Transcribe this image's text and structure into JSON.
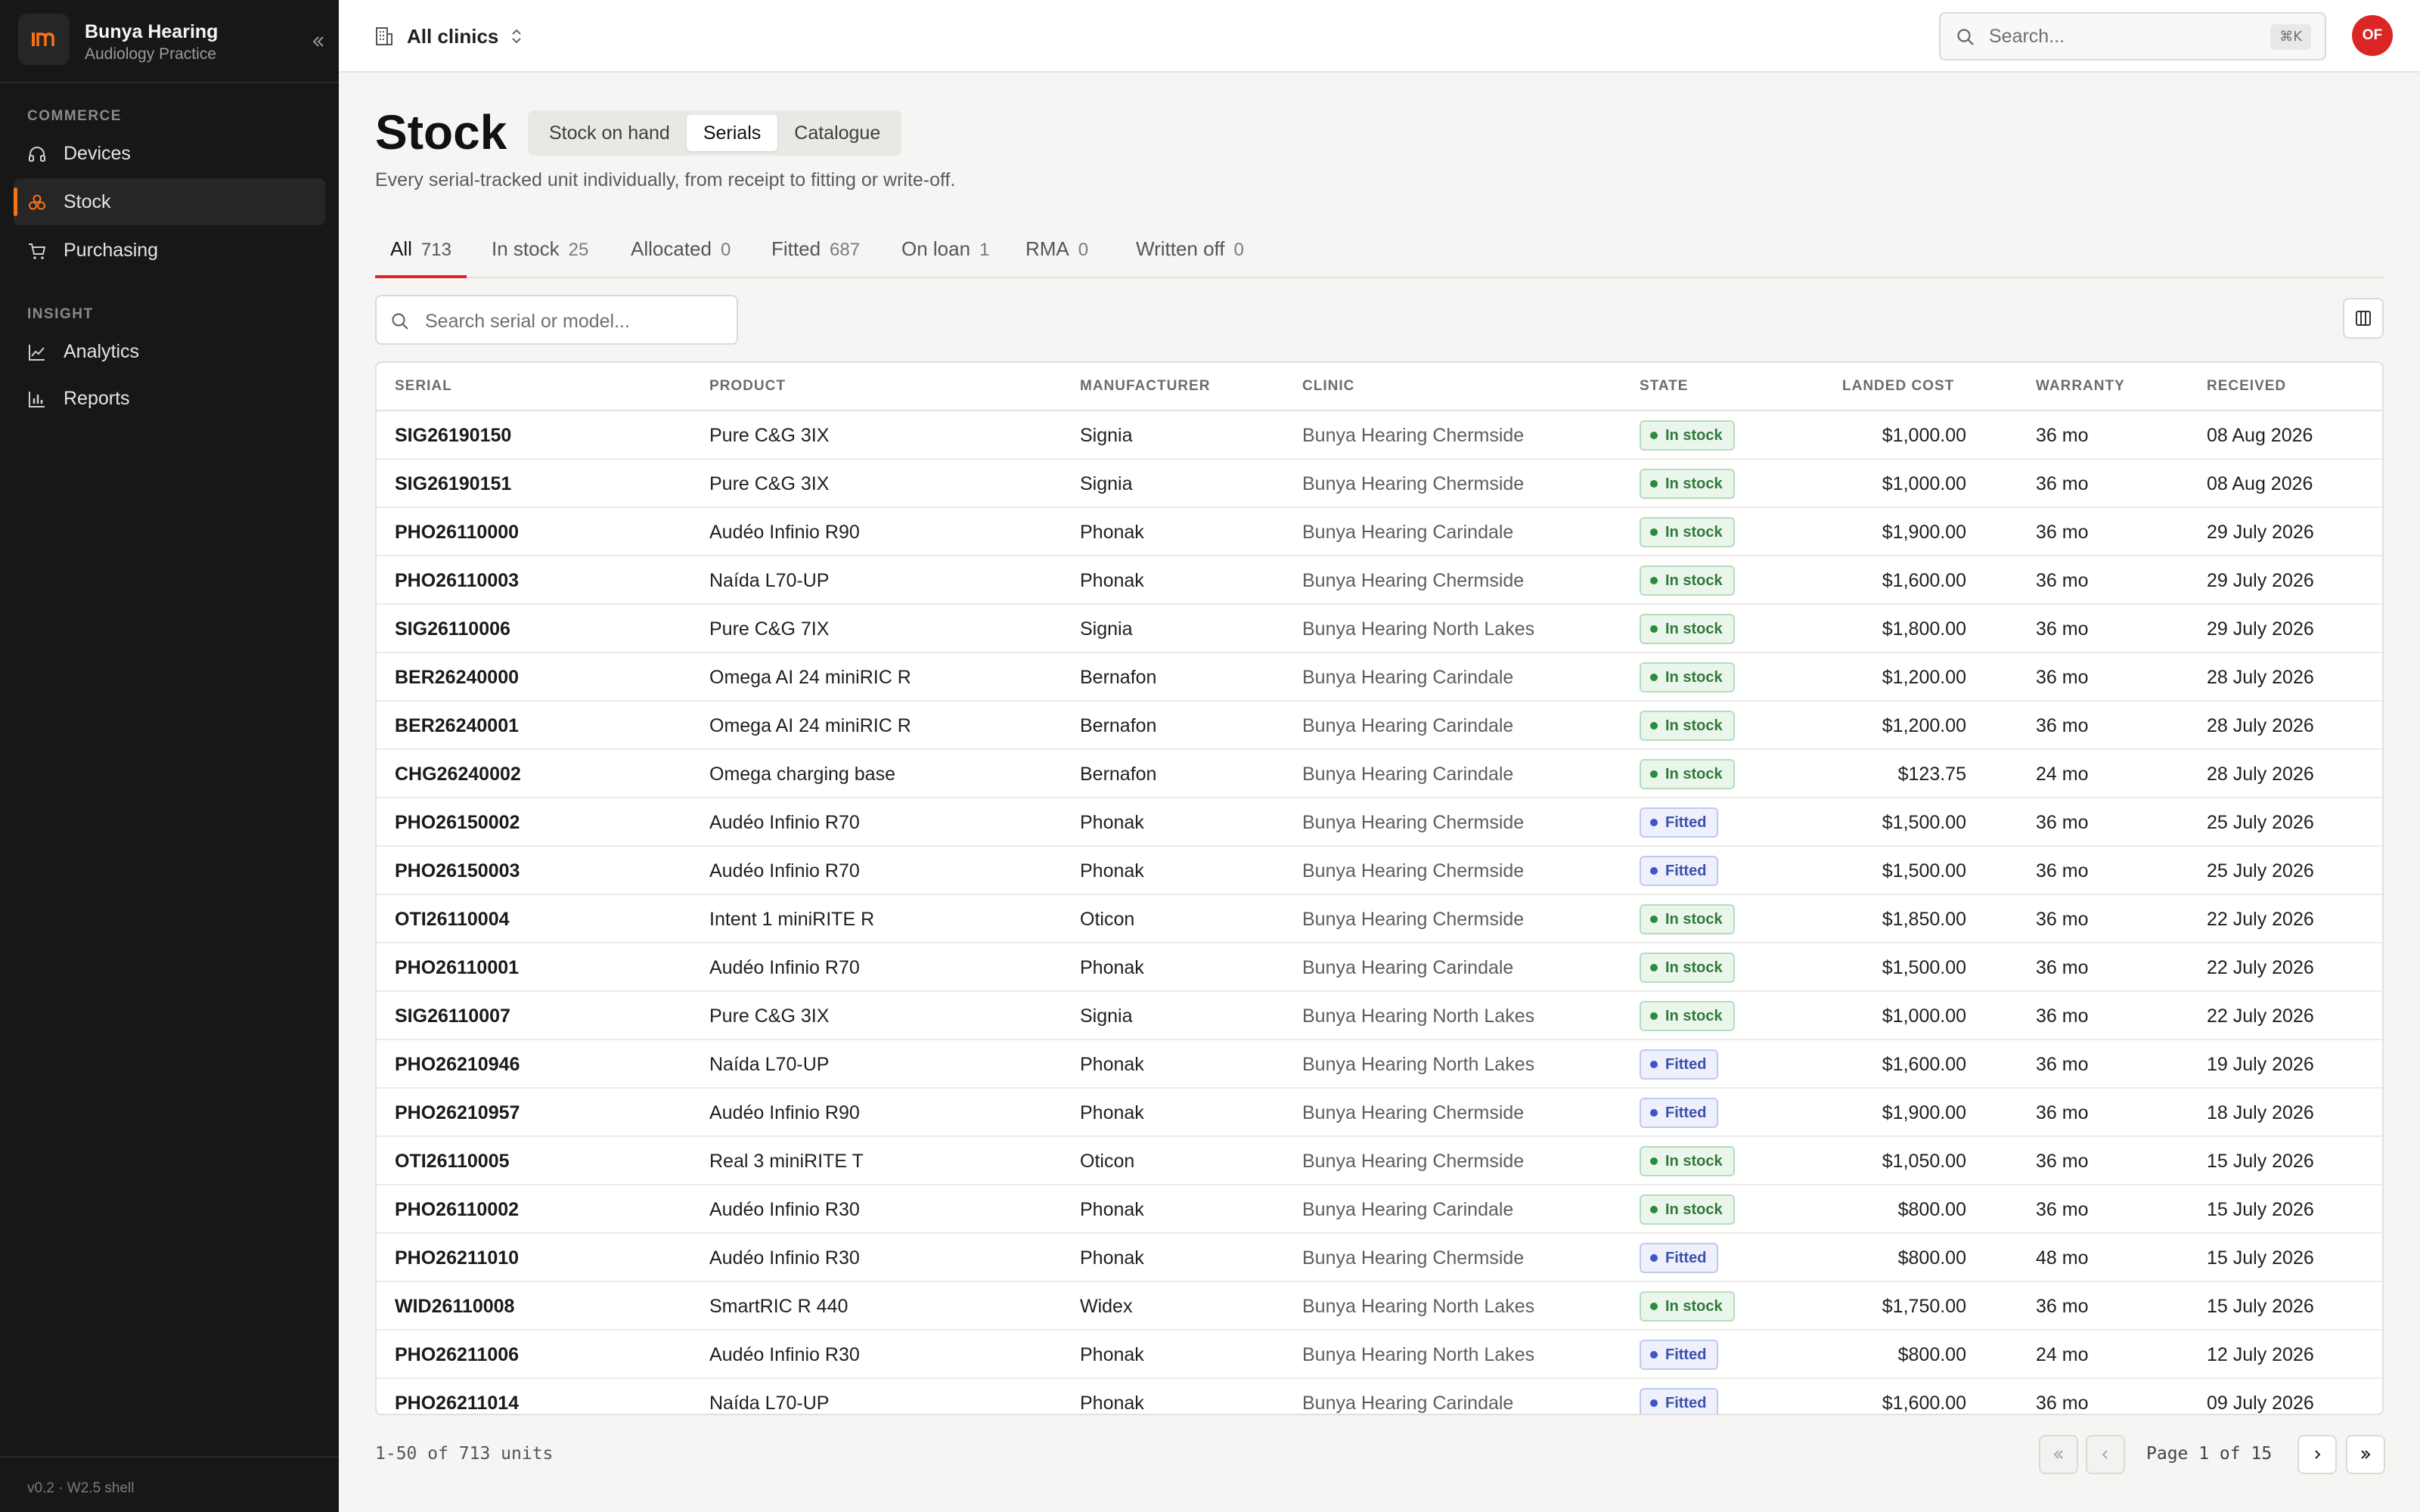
{
  "app": {
    "name": "Bunya Hearing",
    "subtitle": "Audiology Practice",
    "logo_text": "Im",
    "version": "v0.2 · W2.5 shell"
  },
  "sidebar": {
    "sections": [
      {
        "label": "COMMERCE",
        "items": [
          {
            "label": "Devices",
            "icon": "headphones-icon",
            "active": false
          },
          {
            "label": "Stock",
            "icon": "stock-icon",
            "active": true
          },
          {
            "label": "Purchasing",
            "icon": "cart-icon",
            "active": false
          }
        ]
      },
      {
        "label": "INSIGHT",
        "items": [
          {
            "label": "Analytics",
            "icon": "line-chart-icon",
            "active": false
          },
          {
            "label": "Reports",
            "icon": "bar-chart-icon",
            "active": false
          }
        ]
      }
    ]
  },
  "topbar": {
    "clinic_selector": "All clinics",
    "search_placeholder": "Search...",
    "search_shortcut": "⌘K",
    "user_initials": "OF"
  },
  "page": {
    "title": "Stock",
    "views": [
      {
        "label": "Stock on hand",
        "active": false
      },
      {
        "label": "Serials",
        "active": true
      },
      {
        "label": "Catalogue",
        "active": false
      }
    ],
    "subtitle": "Every serial-tracked unit individually, from receipt to fitting or write-off."
  },
  "filters": {
    "tabs": [
      {
        "label": "All",
        "count": "713",
        "active": true
      },
      {
        "label": "In stock",
        "count": "25",
        "active": false
      },
      {
        "label": "Allocated",
        "count": "0",
        "active": false
      },
      {
        "label": "Fitted",
        "count": "687",
        "active": false
      },
      {
        "label": "On loan",
        "count": "1",
        "active": false
      },
      {
        "label": "RMA",
        "count": "0",
        "active": false
      },
      {
        "label": "Written off",
        "count": "0",
        "active": false
      }
    ],
    "search_placeholder": "Search serial or model..."
  },
  "table": {
    "columns": [
      "SERIAL",
      "PRODUCT",
      "MANUFACTURER",
      "CLINIC",
      "STATE",
      "LANDED COST",
      "WARRANTY",
      "RECEIVED"
    ],
    "rows": [
      {
        "serial": "SIG26190150",
        "product": "Pure C&G 3IX",
        "manufacturer": "Signia",
        "clinic": "Bunya Hearing Chermside",
        "state": "In stock",
        "cost": "$1,000.00",
        "warranty": "36 mo",
        "received": "08 Aug 2026"
      },
      {
        "serial": "SIG26190151",
        "product": "Pure C&G 3IX",
        "manufacturer": "Signia",
        "clinic": "Bunya Hearing Chermside",
        "state": "In stock",
        "cost": "$1,000.00",
        "warranty": "36 mo",
        "received": "08 Aug 2026"
      },
      {
        "serial": "PHO26110000",
        "product": "Audéo Infinio R90",
        "manufacturer": "Phonak",
        "clinic": "Bunya Hearing Carindale",
        "state": "In stock",
        "cost": "$1,900.00",
        "warranty": "36 mo",
        "received": "29 July 2026"
      },
      {
        "serial": "PHO26110003",
        "product": "Naída L70-UP",
        "manufacturer": "Phonak",
        "clinic": "Bunya Hearing Chermside",
        "state": "In stock",
        "cost": "$1,600.00",
        "warranty": "36 mo",
        "received": "29 July 2026"
      },
      {
        "serial": "SIG26110006",
        "product": "Pure C&G 7IX",
        "manufacturer": "Signia",
        "clinic": "Bunya Hearing North Lakes",
        "state": "In stock",
        "cost": "$1,800.00",
        "warranty": "36 mo",
        "received": "29 July 2026"
      },
      {
        "serial": "BER26240000",
        "product": "Omega AI 24 miniRIC R",
        "manufacturer": "Bernafon",
        "clinic": "Bunya Hearing Carindale",
        "state": "In stock",
        "cost": "$1,200.00",
        "warranty": "36 mo",
        "received": "28 July 2026"
      },
      {
        "serial": "BER26240001",
        "product": "Omega AI 24 miniRIC R",
        "manufacturer": "Bernafon",
        "clinic": "Bunya Hearing Carindale",
        "state": "In stock",
        "cost": "$1,200.00",
        "warranty": "36 mo",
        "received": "28 July 2026"
      },
      {
        "serial": "CHG26240002",
        "product": "Omega charging base",
        "manufacturer": "Bernafon",
        "clinic": "Bunya Hearing Carindale",
        "state": "In stock",
        "cost": "$123.75",
        "warranty": "24 mo",
        "received": "28 July 2026"
      },
      {
        "serial": "PHO26150002",
        "product": "Audéo Infinio R70",
        "manufacturer": "Phonak",
        "clinic": "Bunya Hearing Chermside",
        "state": "Fitted",
        "cost": "$1,500.00",
        "warranty": "36 mo",
        "received": "25 July 2026"
      },
      {
        "serial": "PHO26150003",
        "product": "Audéo Infinio R70",
        "manufacturer": "Phonak",
        "clinic": "Bunya Hearing Chermside",
        "state": "Fitted",
        "cost": "$1,500.00",
        "warranty": "36 mo",
        "received": "25 July 2026"
      },
      {
        "serial": "OTI26110004",
        "product": "Intent 1 miniRITE R",
        "manufacturer": "Oticon",
        "clinic": "Bunya Hearing Chermside",
        "state": "In stock",
        "cost": "$1,850.00",
        "warranty": "36 mo",
        "received": "22 July 2026"
      },
      {
        "serial": "PHO26110001",
        "product": "Audéo Infinio R70",
        "manufacturer": "Phonak",
        "clinic": "Bunya Hearing Carindale",
        "state": "In stock",
        "cost": "$1,500.00",
        "warranty": "36 mo",
        "received": "22 July 2026"
      },
      {
        "serial": "SIG26110007",
        "product": "Pure C&G 3IX",
        "manufacturer": "Signia",
        "clinic": "Bunya Hearing North Lakes",
        "state": "In stock",
        "cost": "$1,000.00",
        "warranty": "36 mo",
        "received": "22 July 2026"
      },
      {
        "serial": "PHO26210946",
        "product": "Naída L70-UP",
        "manufacturer": "Phonak",
        "clinic": "Bunya Hearing North Lakes",
        "state": "Fitted",
        "cost": "$1,600.00",
        "warranty": "36 mo",
        "received": "19 July 2026"
      },
      {
        "serial": "PHO26210957",
        "product": "Audéo Infinio R90",
        "manufacturer": "Phonak",
        "clinic": "Bunya Hearing Chermside",
        "state": "Fitted",
        "cost": "$1,900.00",
        "warranty": "36 mo",
        "received": "18 July 2026"
      },
      {
        "serial": "OTI26110005",
        "product": "Real 3 miniRITE T",
        "manufacturer": "Oticon",
        "clinic": "Bunya Hearing Chermside",
        "state": "In stock",
        "cost": "$1,050.00",
        "warranty": "36 mo",
        "received": "15 July 2026"
      },
      {
        "serial": "PHO26110002",
        "product": "Audéo Infinio R30",
        "manufacturer": "Phonak",
        "clinic": "Bunya Hearing Carindale",
        "state": "In stock",
        "cost": "$800.00",
        "warranty": "36 mo",
        "received": "15 July 2026"
      },
      {
        "serial": "PHO26211010",
        "product": "Audéo Infinio R30",
        "manufacturer": "Phonak",
        "clinic": "Bunya Hearing Chermside",
        "state": "Fitted",
        "cost": "$800.00",
        "warranty": "48 mo",
        "received": "15 July 2026"
      },
      {
        "serial": "WID26110008",
        "product": "SmartRIC R 440",
        "manufacturer": "Widex",
        "clinic": "Bunya Hearing North Lakes",
        "state": "In stock",
        "cost": "$1,750.00",
        "warranty": "36 mo",
        "received": "15 July 2026"
      },
      {
        "serial": "PHO26211006",
        "product": "Audéo Infinio R30",
        "manufacturer": "Phonak",
        "clinic": "Bunya Hearing North Lakes",
        "state": "Fitted",
        "cost": "$800.00",
        "warranty": "24 mo",
        "received": "12 July 2026"
      },
      {
        "serial": "PHO26211014",
        "product": "Naída L70-UP",
        "manufacturer": "Phonak",
        "clinic": "Bunya Hearing Carindale",
        "state": "Fitted",
        "cost": "$1,600.00",
        "warranty": "36 mo",
        "received": "09 July 2026"
      }
    ]
  },
  "pagination": {
    "summary": "1-50 of 713 units",
    "page_indicator": "Page 1 of 15"
  },
  "colors": {
    "accent": "#f97316",
    "brand_red": "#dc2626",
    "sidebar_bg": "#171717",
    "in_stock": "#2f8a3e",
    "fitted": "#3d57c9"
  }
}
